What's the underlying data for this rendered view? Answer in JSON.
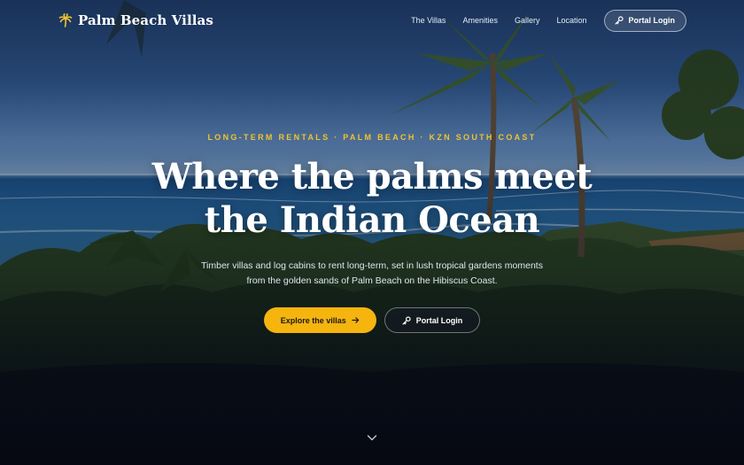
{
  "brand": {
    "name": "Palm Beach Villas",
    "icon": "palm-tree-icon",
    "accent": "#f0c330"
  },
  "nav": {
    "links": [
      "The Villas",
      "Amenities",
      "Gallery",
      "Location"
    ],
    "portal_label": "Portal Login",
    "portal_icon": "key-icon"
  },
  "hero": {
    "eyebrow": "LONG-TERM RENTALS · PALM BEACH · KZN SOUTH COAST",
    "headline_line1": "Where the palms meet",
    "headline_line2": "the Indian Ocean",
    "subtitle": "Timber villas and log cabins to rent long-term, set in lush tropical gardens moments from the golden sands of Palm Beach on the Hibiscus Coast.",
    "primary_cta": "Explore the villas",
    "primary_icon": "arrow-right-icon",
    "secondary_cta": "Portal Login",
    "secondary_icon": "key-icon",
    "scroll_icon": "chevron-down-icon"
  },
  "colors": {
    "primary_button": "#f6b40e",
    "eyebrow": "#f0c330"
  }
}
